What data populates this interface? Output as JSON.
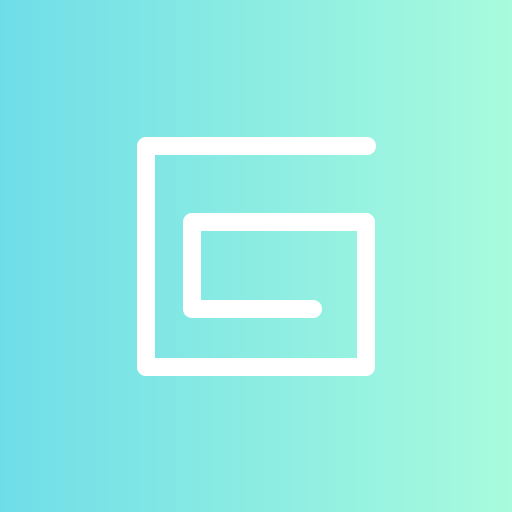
{
  "background": {
    "gradient_start": "#6FDDE8",
    "gradient_end": "#A8FBDD",
    "direction": "left-to-right"
  },
  "logo": {
    "icon": "spiral-g-logo",
    "stroke_color": "#FFFFFF"
  }
}
